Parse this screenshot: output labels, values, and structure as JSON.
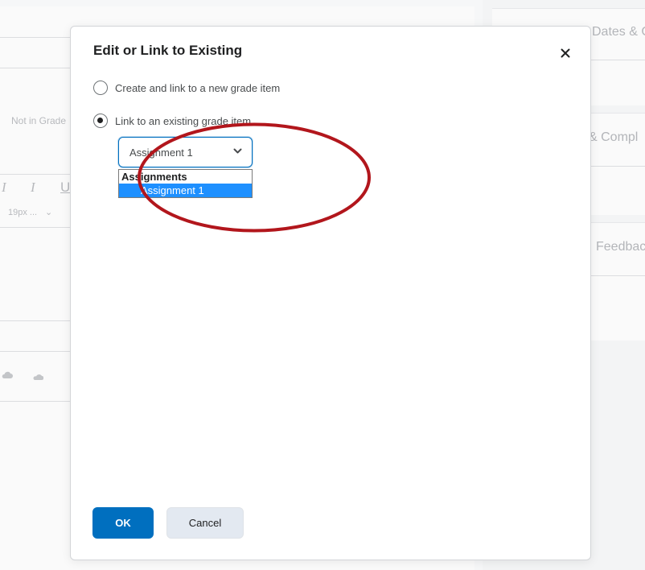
{
  "background": {
    "left_label": "Not in Grade",
    "font_size_label": "19px ...",
    "italic_glyph": "I",
    "underline_glyph": "U",
    "dates_card_title": "Dates & C",
    "completion_card_title": "& Compl",
    "feedback_card_title": "Feedbac"
  },
  "dialog": {
    "title": "Edit or Link to Existing",
    "close_icon": "close-icon",
    "option_create": "Create and link to a new grade item",
    "option_link": "Link to an existing grade item",
    "selected_option": "link",
    "select_value": "Assignment 1",
    "dropdown": {
      "group_label": "Assignments",
      "options": [
        "Assignment 1"
      ],
      "highlighted": "Assignment 1"
    },
    "ok_label": "OK",
    "cancel_label": "Cancel"
  },
  "colors": {
    "primary": "#006fbf",
    "highlight": "#1e90ff",
    "annotation": "#b2161c"
  }
}
